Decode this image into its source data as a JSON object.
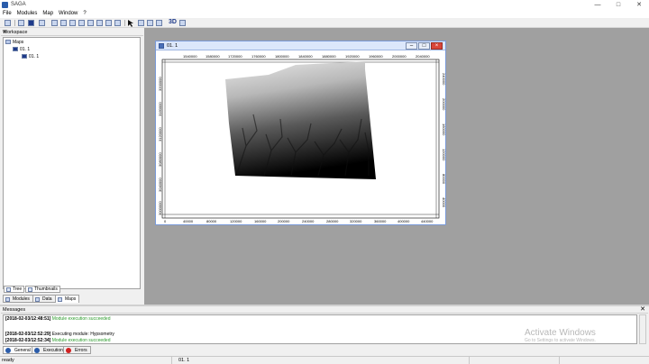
{
  "window": {
    "title": "SAGA",
    "minimize": "—",
    "maximize": "□",
    "close": "✕"
  },
  "menu": [
    "File",
    "Modules",
    "Map",
    "Window",
    "?"
  ],
  "workspace": {
    "title": "Workspace",
    "close": "✕",
    "tree": {
      "root": "Maps",
      "map_node": "01. 1",
      "layer_node": "01. 1"
    },
    "subtabs": [
      "Tree",
      "Thumbnails"
    ],
    "tabs": [
      "Modules",
      "Data",
      "Maps"
    ]
  },
  "map_window": {
    "title": "01. 1",
    "top_ticks": [
      "1540000",
      "1580000",
      "1720000",
      "1760000",
      "1800000",
      "1840000",
      "1880000",
      "1920000",
      "1960000",
      "2000000",
      "2040000"
    ],
    "bottom_ticks": [
      "0",
      "40000",
      "80000",
      "120000",
      "160000",
      "200000",
      "240000",
      "280000",
      "320000",
      "360000",
      "400000",
      "440000"
    ],
    "left_ticks": [
      "3200000",
      "3160000",
      "3120000",
      "3080000",
      "3040000",
      "3000000"
    ],
    "right_ticks": [
      "240000",
      "200000",
      "160000",
      "120000",
      "80000",
      "40000"
    ]
  },
  "messages": {
    "title": "Messages",
    "close": "✕",
    "lines": [
      {
        "ts": "[2018-02-03/12:48:51]",
        "text": "Module execution succeeded",
        "status": "ok"
      },
      {
        "ts": "[2018-02-03/12:52:29]",
        "text": "Executing module: Hypsometry",
        "status": "plain"
      },
      {
        "ts": "[2018-02-03/12:52:34]",
        "text": "Module execution succeeded",
        "status": "ok"
      }
    ],
    "tabs": [
      "General",
      "Execution",
      "Errors"
    ]
  },
  "watermark": {
    "line1": "Activate Windows",
    "line2": "Go to Settings to activate Windows."
  },
  "status": {
    "left": "ready",
    "map": "01. 1"
  },
  "colors": {
    "ok": "#2a9a2a",
    "error": "#d02020",
    "accent": "#1e3a8a"
  }
}
